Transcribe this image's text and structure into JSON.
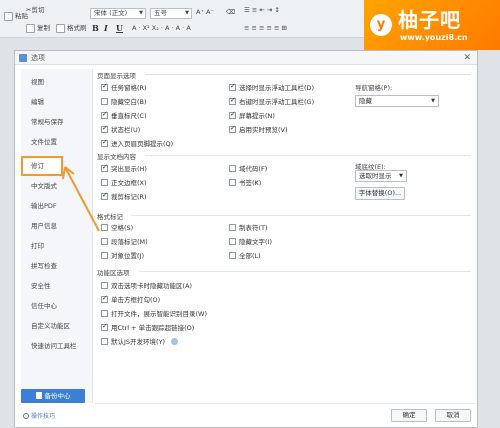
{
  "toolbar": {
    "cut": "剪切",
    "paste": "粘贴",
    "copy": "复制",
    "format_painter": "格式刷",
    "font_name": "宋体 (正文)",
    "font_size": "五号",
    "bold": "B",
    "italic": "I",
    "underline": "U"
  },
  "watermark": {
    "brand": "柚子吧",
    "url": "www.youzi8.cn",
    "mark": "y"
  },
  "dialog": {
    "title": "选项",
    "close": "✕"
  },
  "sidebar": {
    "items": [
      {
        "label": "视图"
      },
      {
        "label": "编辑"
      },
      {
        "label": "常规与保存"
      },
      {
        "label": "文件位置"
      },
      {
        "label": "修订"
      },
      {
        "label": "中文版式"
      },
      {
        "label": "输出PDF"
      },
      {
        "label": "用户信息"
      },
      {
        "label": "打印"
      },
      {
        "label": "拼写检查"
      },
      {
        "label": "安全性"
      },
      {
        "label": "信任中心"
      },
      {
        "label": "自定义功能区"
      },
      {
        "label": "快速访问工具栏"
      }
    ],
    "active_index": 4,
    "backup_label": "备份中心",
    "tips_label": "操作技巧"
  },
  "page_display": {
    "title": "页面显示选项",
    "col1": [
      {
        "label": "任务窗格(R)",
        "checked": true
      },
      {
        "label": "隐藏空白(B)",
        "checked": false
      },
      {
        "label": "垂直标尺(C)",
        "checked": true
      },
      {
        "label": "状态栏(U)",
        "checked": true
      },
      {
        "label": "进入页眉页脚提示(Q)",
        "checked": true
      }
    ],
    "col2": [
      {
        "label": "选择时显示浮动工具栏(D)",
        "checked": true
      },
      {
        "label": "右键时显示浮动工具栏(G)",
        "checked": true
      },
      {
        "label": "屏幕提示(N)",
        "checked": true
      },
      {
        "label": "启用实时预览(V)",
        "checked": true
      }
    ],
    "nav_label": "导航窗格(P):",
    "nav_value": "隐藏"
  },
  "show_content": {
    "title": "显示文档内容",
    "col1": [
      {
        "label": "突出显示(H)",
        "checked": true
      },
      {
        "label": "正文边框(X)",
        "checked": false
      },
      {
        "label": "裁剪标记(R)",
        "checked": true
      }
    ],
    "col2": [
      {
        "label": "域代码(F)",
        "checked": false
      },
      {
        "label": "书签(K)",
        "checked": false
      }
    ],
    "field_label": "域底纹(E):",
    "field_value": "选取时显示",
    "font_replace": "字体替换(O)..."
  },
  "format_marks": {
    "title": "格式标记",
    "col1": [
      {
        "label": "空格(S)",
        "checked": false
      },
      {
        "label": "段落标记(M)",
        "checked": false
      },
      {
        "label": "对象位置(J)",
        "checked": false
      }
    ],
    "col2": [
      {
        "label": "制表符(T)",
        "checked": false
      },
      {
        "label": "隐藏文字(I)",
        "checked": false
      },
      {
        "label": "全部(L)",
        "checked": false
      }
    ]
  },
  "ribbon": {
    "title": "功能区选项",
    "items": [
      {
        "label": "双击选项卡时隐藏功能区(A)",
        "checked": false
      },
      {
        "label": "单击方框打勾(O)",
        "checked": true
      },
      {
        "label": "打开文件，展示智能识别目录(W)",
        "checked": false
      },
      {
        "label": "用Ctrl + 单击跟踪超链接(O)",
        "checked": true
      },
      {
        "label": "默认JS开发环境(Y)",
        "checked": false
      }
    ]
  },
  "footer": {
    "ok": "确定",
    "cancel": "取消"
  },
  "colors": {
    "accent": "#f29a2e",
    "primary": "#3d7fd6",
    "watermark": "#ff8c00"
  }
}
